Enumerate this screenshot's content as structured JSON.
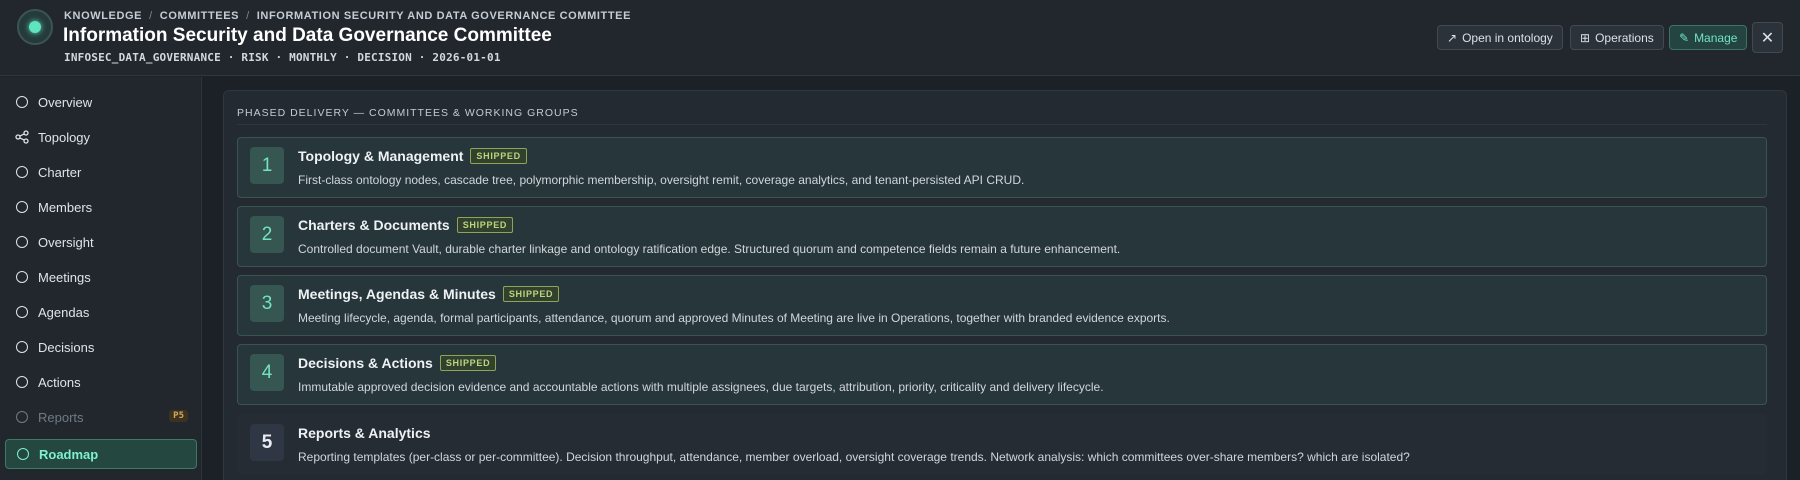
{
  "header": {
    "breadcrumbs": [
      "KNOWLEDGE",
      "COMMITTEES",
      "INFORMATION SECURITY AND DATA GOVERNANCE COMMITTEE"
    ],
    "title": "Information Security and Data Governance Committee",
    "meta": "INFOSEC_DATA_GOVERNANCE · RISK · MONTHLY · DECISION · 2026-01-01",
    "buttons": {
      "open_ontology": "Open in ontology",
      "operations": "Operations",
      "manage": "Manage"
    },
    "icons": {
      "open_ontology": "↗",
      "operations": "⊞",
      "manage": "✎",
      "close": "✕"
    }
  },
  "sidebar": {
    "items": [
      {
        "label": "Overview"
      },
      {
        "label": "Topology"
      },
      {
        "label": "Charter"
      },
      {
        "label": "Members"
      },
      {
        "label": "Oversight"
      },
      {
        "label": "Meetings"
      },
      {
        "label": "Agendas"
      },
      {
        "label": "Decisions"
      },
      {
        "label": "Actions"
      },
      {
        "label": "Reports",
        "badge": "P5",
        "disabled": true
      },
      {
        "label": "Roadmap",
        "active": true
      }
    ]
  },
  "main": {
    "section_label": "PHASED DELIVERY — COMMITTEES & WORKING GROUPS",
    "phases": [
      {
        "number": "1",
        "title": "Topology & Management",
        "status": "SHIPPED",
        "description": "First-class ontology nodes, cascade tree, polymorphic membership, oversight remit, coverage analytics, and tenant-persisted API CRUD."
      },
      {
        "number": "2",
        "title": "Charters & Documents",
        "status": "SHIPPED",
        "description": "Controlled document Vault, durable charter linkage and ontology ratification edge. Structured quorum and competence fields remain a future enhancement."
      },
      {
        "number": "3",
        "title": "Meetings, Agendas & Minutes",
        "status": "SHIPPED",
        "description": "Meeting lifecycle, agenda, formal participants, attendance, quorum and approved Minutes of Meeting are live in Operations, together with branded evidence exports."
      },
      {
        "number": "4",
        "title": "Decisions & Actions",
        "status": "SHIPPED",
        "description": "Immutable approved decision evidence and accountable actions with multiple assignees, due targets, attribution, priority, criticality and delivery lifecycle."
      },
      {
        "number": "5",
        "title": "Reports & Analytics",
        "status": "",
        "description": "Reporting templates (per-class or per-committee). Decision throughput, attendance, member overload, oversight coverage trends. Network analysis: which committees over-share members? which are isolated?"
      }
    ]
  },
  "colors": {
    "accent": "#5fe3c0",
    "shipped": "#b7d680",
    "background": "#1c2127"
  }
}
